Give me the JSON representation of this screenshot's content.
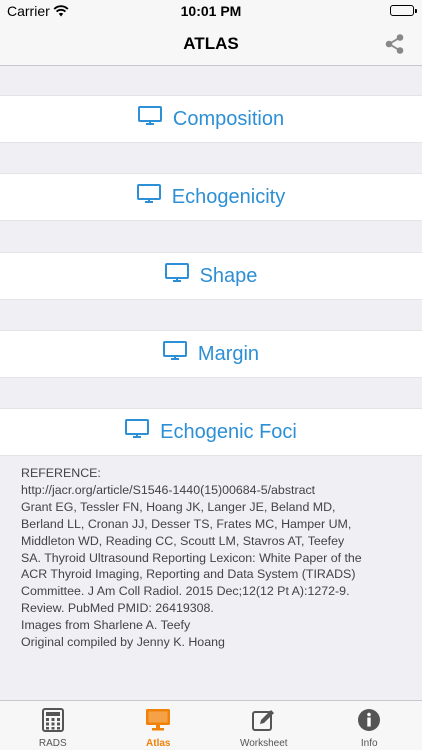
{
  "status_bar": {
    "carrier": "Carrier",
    "time": "10:01 PM"
  },
  "nav": {
    "title": "ATLAS",
    "share_icon": "share-icon"
  },
  "atlas_items": [
    {
      "label": "Composition",
      "icon": "monitor-icon"
    },
    {
      "label": "Echogenicity",
      "icon": "monitor-icon"
    },
    {
      "label": "Shape",
      "icon": "monitor-icon"
    },
    {
      "label": "Margin",
      "icon": "monitor-icon"
    },
    {
      "label": "Echogenic Foci",
      "icon": "monitor-icon"
    }
  ],
  "reference": {
    "text": "REFERENCE:\nhttp://jacr.org/article/S1546-1440(15)00684-5/abstract\nGrant EG, Tessler FN, Hoang JK, Langer JE, Beland MD,\nBerland LL, Cronan JJ, Desser TS, Frates MC, Hamper UM,\nMiddleton WD, Reading CC, Scoutt LM, Stavros AT, Teefey\nSA. Thyroid Ultrasound Reporting Lexicon: White Paper of the\nACR Thyroid Imaging, Reporting and Data System (TIRADS)\nCommittee. J Am Coll Radiol. 2015 Dec;12(12 Pt A):1272-9.\nReview. PubMed PMID: 26419308.\nImages from Sharlene A. Teefy\nOriginal compiled by Jenny K. Hoang"
  },
  "tabs": [
    {
      "label": "RADS",
      "icon": "calculator-icon",
      "active": false
    },
    {
      "label": "Atlas",
      "icon": "monitor-icon",
      "active": true
    },
    {
      "label": "Worksheet",
      "icon": "edit-icon",
      "active": false
    },
    {
      "label": "Info",
      "icon": "info-icon",
      "active": false
    }
  ],
  "colors": {
    "accent": "#2d8fd5",
    "active_tab": "#f0820a",
    "inactive_tab": "#555555",
    "background": "#efeff4"
  }
}
